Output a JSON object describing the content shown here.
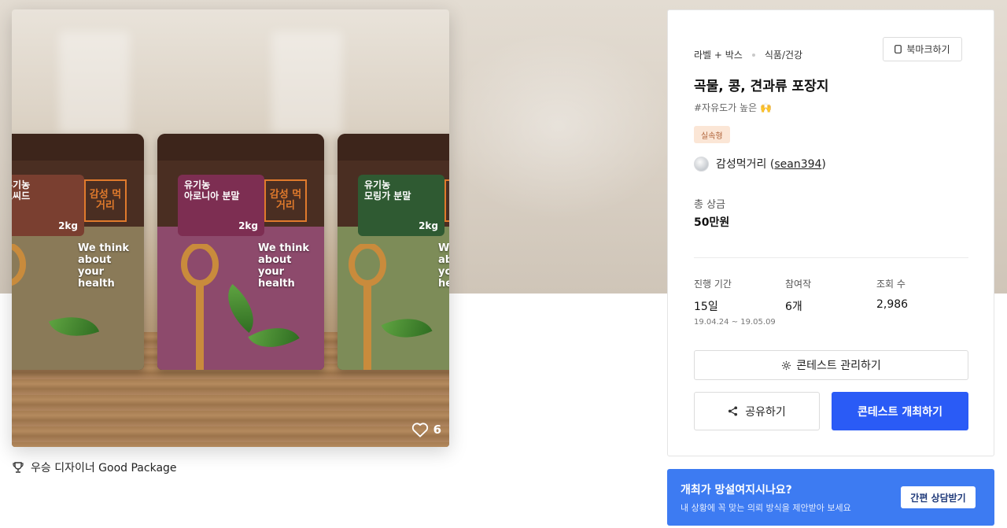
{
  "hero": {
    "like_count": "6",
    "bags": [
      {
        "title": "유기농",
        "subtitle": "프씨드",
        "kg": "2kg",
        "label_color": "#7a3f30",
        "fill": "#8a7a58"
      },
      {
        "title": "유기농",
        "subtitle": "아로니아 분말",
        "kg": "2kg",
        "label_color": "#7d2e52",
        "fill": "#8d4a6c"
      },
      {
        "title": "유기농",
        "subtitle": "모링가 분말",
        "kg": "2kg",
        "label_color": "#2f5a32",
        "fill": "#7d8c58"
      }
    ],
    "brand_text": "감성 먹거리",
    "slogan": "We think about your health"
  },
  "award": {
    "icon": "trophy-icon",
    "text": "우승 디자이너 Good Package"
  },
  "panel": {
    "breadcrumb": [
      "라벨 + 박스",
      "식품/건강"
    ],
    "bookmark_label": "북마크하기",
    "title": "곡물, 콩, 견과류 포장지",
    "tagline": "#자유도가 높은",
    "tagline_emoji": "🙌",
    "badge": "실속형",
    "host_name": "감성먹거리",
    "host_handle": "sean394",
    "prize_label": "총 상금",
    "prize_value": "50만원",
    "stats": [
      {
        "label": "진행 기간",
        "value": "15일",
        "sub": "19.04.24 ~ 19.05.09"
      },
      {
        "label": "참여작",
        "value": "6개",
        "sub": ""
      },
      {
        "label": "조회 수",
        "value": "2,986",
        "sub": ""
      }
    ],
    "manage_label": "콘테스트 관리하기",
    "share_label": "공유하기",
    "host_contest_label": "콘테스트 개최하기"
  },
  "consult": {
    "question": "개최가 망설여지시나요?",
    "subtext": "내 상황에 꼭 맞는 의뢰 방식을 제안받아 보세요",
    "button_label": "간편 상담받기"
  },
  "colors": {
    "primary": "#2a5bf6",
    "banner": "#3d7bf2",
    "badge_bg": "#fbe6d6",
    "badge_text": "#b0643a"
  }
}
